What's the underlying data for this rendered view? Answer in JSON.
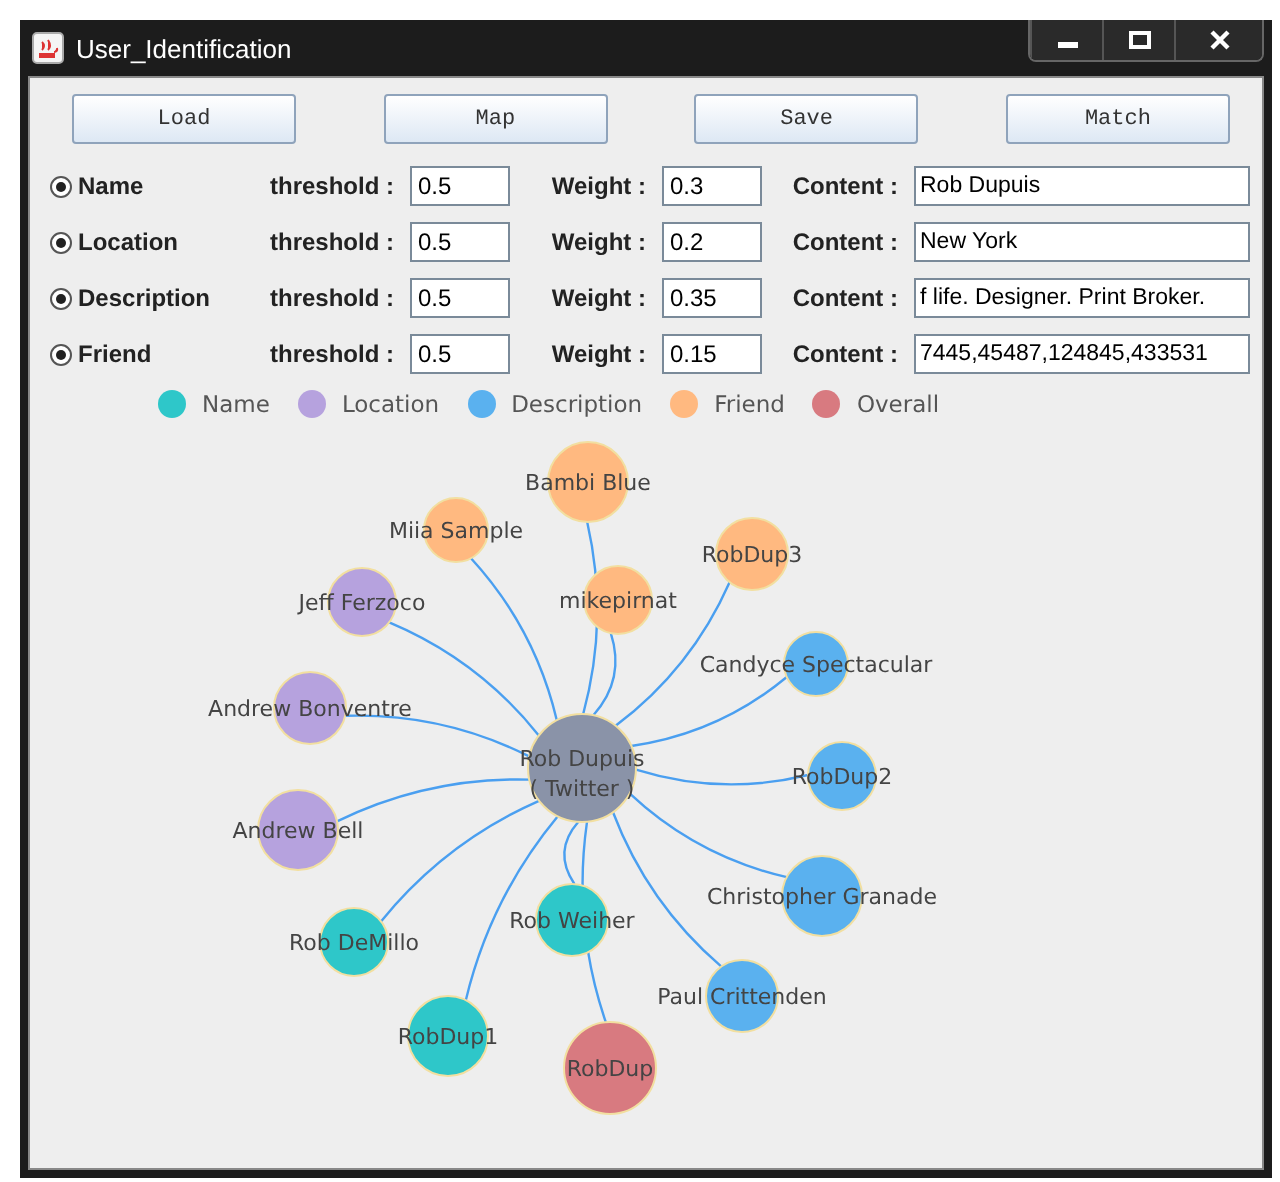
{
  "window": {
    "title": "User_Identification"
  },
  "buttons": [
    "Load",
    "Map",
    "Save",
    "Match"
  ],
  "criteria": [
    {
      "name": "Name",
      "selected": true,
      "threshold_label": "threshold :",
      "threshold": "0.5",
      "weight_label": "Weight :",
      "weight": "0.3",
      "content_label": "Content :",
      "content": "Rob Dupuis"
    },
    {
      "name": "Location",
      "selected": true,
      "threshold_label": "threshold :",
      "threshold": "0.5",
      "weight_label": "Weight :",
      "weight": "0.2",
      "content_label": "Content :",
      "content": "New York"
    },
    {
      "name": "Description",
      "selected": true,
      "threshold_label": "threshold :",
      "threshold": "0.5",
      "weight_label": "Weight :",
      "weight": "0.35",
      "content_label": "Content :",
      "content": "f life. Designer. Print Broker."
    },
    {
      "name": "Friend",
      "selected": true,
      "threshold_label": "threshold :",
      "threshold": "0.5",
      "weight_label": "Weight :",
      "weight": "0.15",
      "content_label": "Content :",
      "content": "7445,45487,124845,433531"
    }
  ],
  "legend": [
    {
      "label": "Name",
      "color": "#2ec7c9"
    },
    {
      "label": "Location",
      "color": "#b6a2de"
    },
    {
      "label": "Description",
      "color": "#5ab1ef"
    },
    {
      "label": "Friend",
      "color": "#ffb980"
    },
    {
      "label": "Overall",
      "color": "#d87a80"
    }
  ],
  "graph": {
    "center": {
      "name": "Rob Dupuis",
      "sub": "( Twitter )"
    },
    "nodes": [
      {
        "name": "Bambi Blue",
        "kind": "friend"
      },
      {
        "name": "Miia Sample",
        "kind": "friend"
      },
      {
        "name": "RobDup3",
        "kind": "friend"
      },
      {
        "name": "Jeff Ferzoco",
        "kind": "location"
      },
      {
        "name": "mikepirnat",
        "kind": "friend"
      },
      {
        "name": "Candyce Spectacular",
        "kind": "description"
      },
      {
        "name": "Andrew Bonventre",
        "kind": "location"
      },
      {
        "name": "RobDup2",
        "kind": "description"
      },
      {
        "name": "Andrew Bell",
        "kind": "location"
      },
      {
        "name": "Christopher Granade",
        "kind": "description"
      },
      {
        "name": "Rob Weiher",
        "kind": "name"
      },
      {
        "name": "Rob DeMillo",
        "kind": "name"
      },
      {
        "name": "Paul Crittenden",
        "kind": "description"
      },
      {
        "name": "RobDup1",
        "kind": "name"
      },
      {
        "name": "RobDup",
        "kind": "overall"
      }
    ]
  }
}
